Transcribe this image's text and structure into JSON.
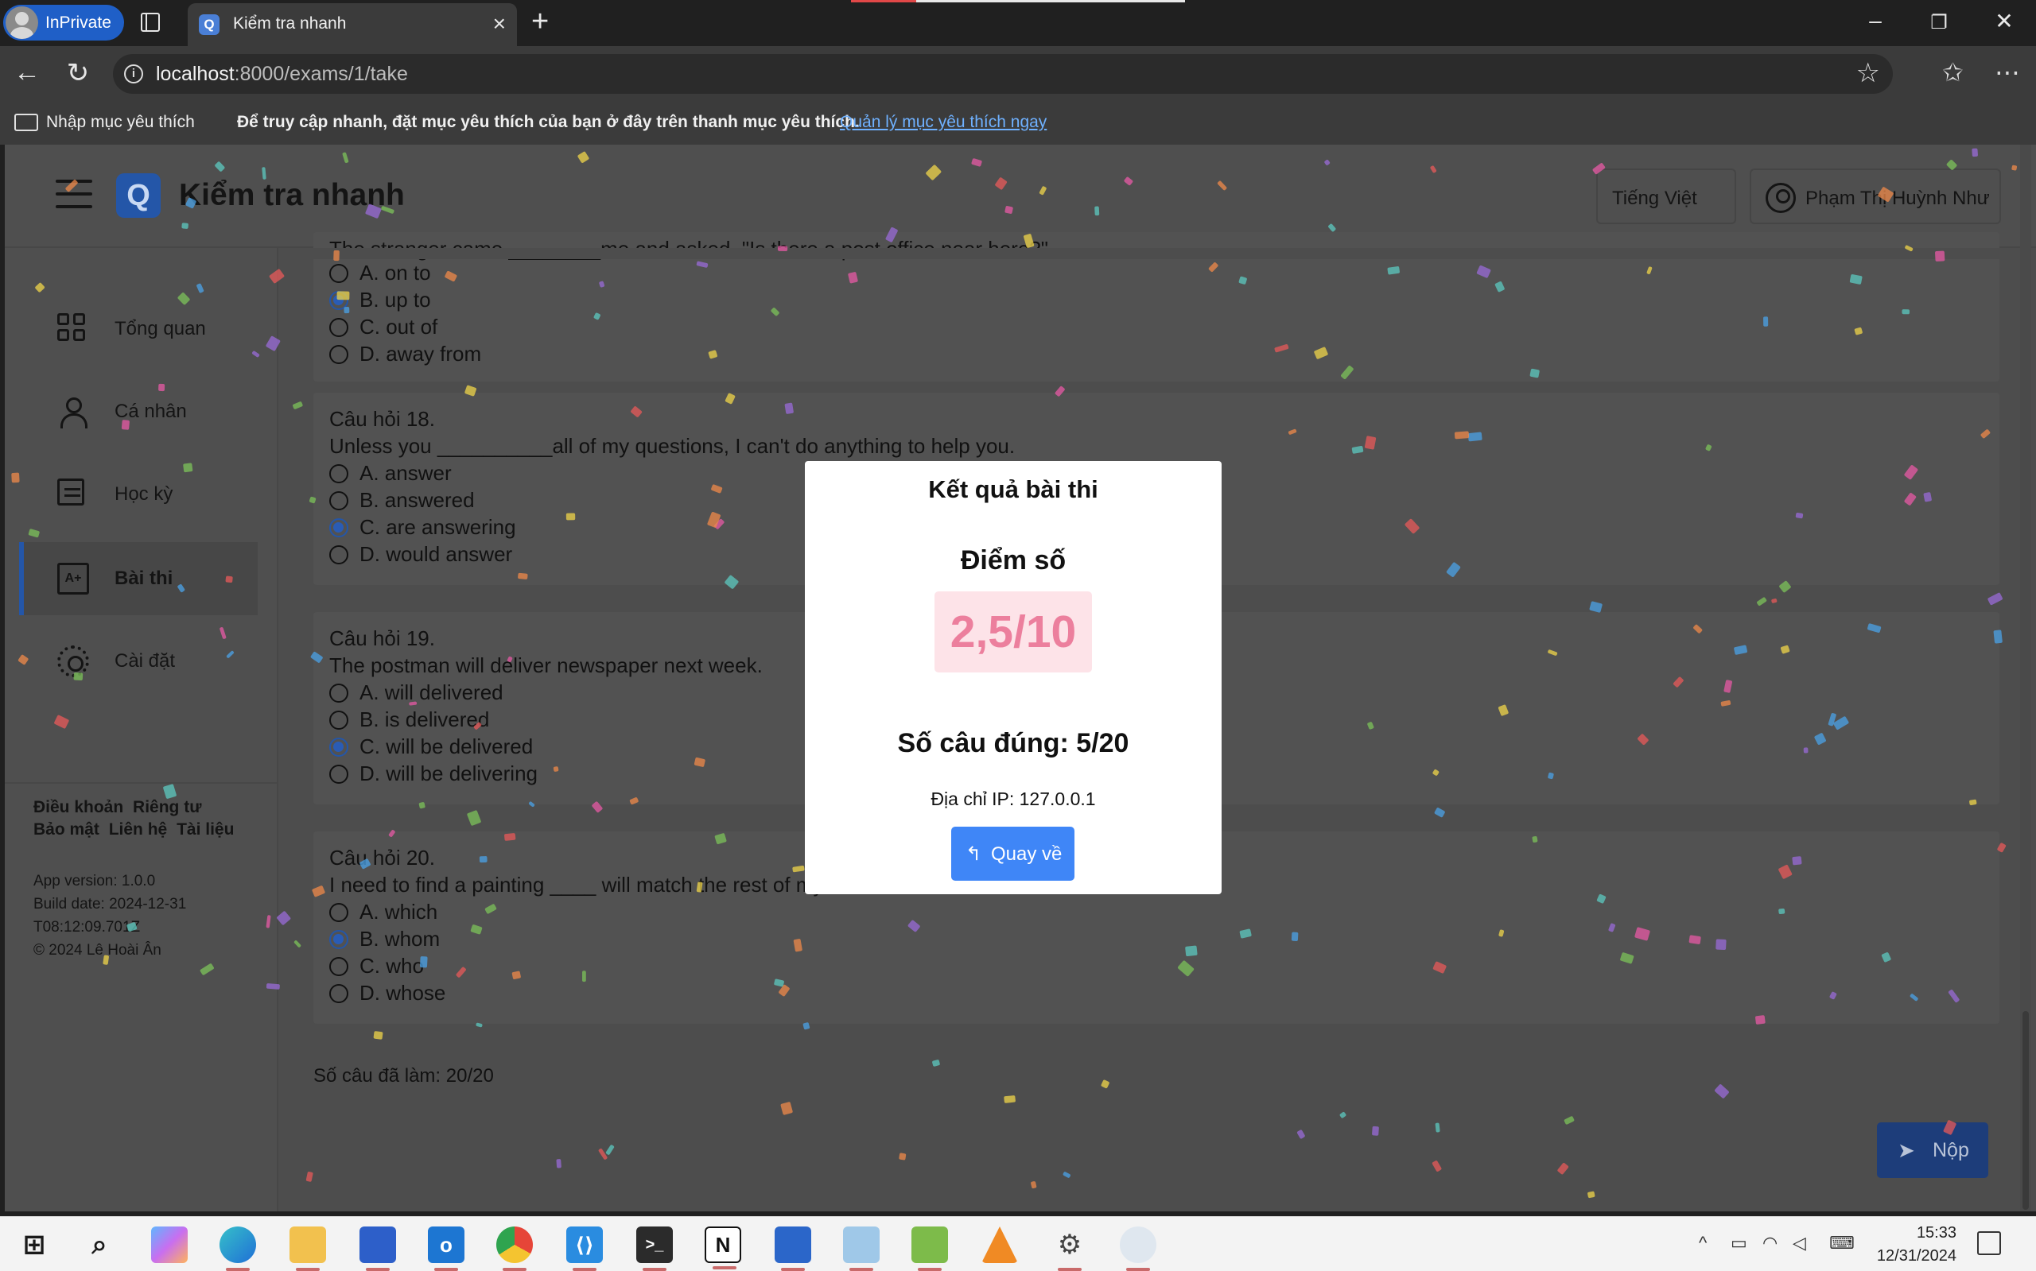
{
  "browser": {
    "inprivate_label": "InPrivate",
    "tab_title": "Kiểm tra nhanh",
    "url_host": "localhost",
    "url_path": ":8000/exams/1/take",
    "favbar": {
      "import_label": "Nhập mục yêu thích",
      "hint": "Để truy cập nhanh, đặt mục yêu thích của bạn ở đây trên thanh mục yêu thích.",
      "manage_link": "Quản lý mục yêu thích ngay"
    }
  },
  "app": {
    "title": "Kiểm tra nhanh",
    "logo_letter": "Q",
    "language": "Tiếng Việt",
    "user_name": "Phạm Thị Huỳnh Như"
  },
  "sidebar": {
    "items": [
      {
        "label": "Tổng quan",
        "icon": "grid-icon"
      },
      {
        "label": "Cá nhân",
        "icon": "user-icon"
      },
      {
        "label": "Học kỳ",
        "icon": "note-icon"
      },
      {
        "label": "Bài thi",
        "icon": "grade-icon",
        "active": true
      },
      {
        "label": "Cài đặt",
        "icon": "gear-icon"
      }
    ],
    "footer_links": [
      "Điều khoản",
      "Riêng tư",
      "Bảo mật",
      "Liên hệ",
      "Tài liệu"
    ],
    "app_version": "App version: 1.0.0",
    "build_date": "Build date: 2024-12-31T08:12:09.701Z",
    "copyright": "© 2024 Lê Hoài Ân"
  },
  "exam": {
    "questions": [
      {
        "title": "",
        "text": "The stranger came ________me and asked, \"Is there a post office near here?\"",
        "options": [
          "A. on to",
          "B. up to",
          "C. out of",
          "D. away from"
        ],
        "selected": 1
      },
      {
        "title": "Câu hỏi 18.",
        "text": "Unless you __________all of my questions, I can't do anything to help you.",
        "options": [
          "A. answer",
          "B. answered",
          "C. are answering",
          "D. would answer"
        ],
        "selected": 2
      },
      {
        "title": "Câu hỏi 19.",
        "text": "The postman will deliver newspaper next week.",
        "options": [
          "A. will delivered",
          "B. is delivered",
          "C. will be delivered",
          "D. will be delivering"
        ],
        "selected": 2
      },
      {
        "title": "Câu hỏi 20.",
        "text": "I need to find a painting ____ will match the rest of my room.",
        "options": [
          "A. which",
          "B. whom",
          "C. who",
          "D. whose"
        ],
        "selected": 1
      }
    ],
    "answered_count": "Số câu đã làm: 20/20",
    "submit_label": "Nộp"
  },
  "result_modal": {
    "title": "Kết quả bài thi",
    "score_label": "Điểm số",
    "score": "2,5/10",
    "correct_count": "Số câu đúng: 5/20",
    "ip": "Địa chỉ IP: 127.0.0.1",
    "back_label": "Quay về"
  },
  "taskbar": {
    "time": "15:33",
    "date": "12/31/2024"
  },
  "colors": {
    "accent": "#2456a8",
    "score_text": "#ec7f9d",
    "score_bg": "#fde3e8",
    "back_button": "#3f86f7"
  }
}
